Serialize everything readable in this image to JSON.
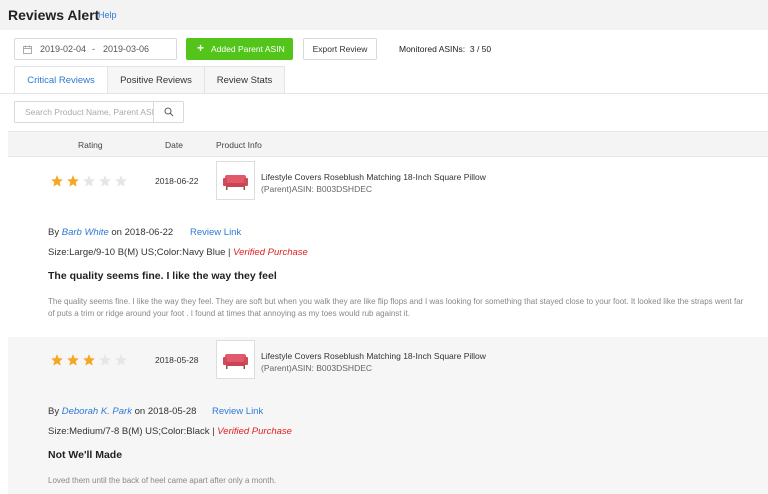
{
  "header": {
    "title": "Reviews Alert",
    "help": "Help"
  },
  "toolbar": {
    "date_start": "2019-02-04",
    "date_sep": "-",
    "date_end": "2019-03-06",
    "add_label": "Added Parent ASIN",
    "export_label": "Export Review",
    "monitored_label": "Monitored ASINs:",
    "monitored_value": "3 / 50",
    "accent": "#52c41a"
  },
  "tabs": [
    {
      "label": "Critical Reviews",
      "active": true
    },
    {
      "label": "Positive Reviews",
      "active": false
    },
    {
      "label": "Review Stats",
      "active": false
    }
  ],
  "search": {
    "placeholder": "Search Product Name, Parent ASIN",
    "icon": "search-icon"
  },
  "table": {
    "columns": [
      "Rating",
      "Date",
      "Product Info"
    ],
    "reviews": [
      {
        "rating": 2,
        "date": "2018-06-22",
        "product_title": "Lifestyle Covers Roseblush Matching 18-Inch Square Pillow",
        "product_asin": "(Parent)ASIN: B003DSHDEC",
        "by": "By",
        "author": "Barb White",
        "on": "on 2018-06-22",
        "review_link": "Review Link",
        "size": "Size:Large/9-10 B(M) US;Color:Navy Blue |",
        "verified": "Verified Purchase",
        "title": "The quality seems fine. I like the way they feel",
        "body_1": "The quality seems fine. I like the way they feel. They are soft but when you walk they are like flip flops and I was looking for something that stayed close to your foot. It looked like the straps went far",
        "body_2": "of puts a trim or ridge around your foot . I found at times that annoying as my toes would rub against it."
      },
      {
        "rating": 3,
        "date": "2018-05-28",
        "product_title": "Lifestyle Covers Roseblush Matching 18-Inch Square Pillow",
        "product_asin": "(Parent)ASIN: B003DSHDEC",
        "by": "By",
        "author": "Deborah K. Park",
        "on": "on 2018-05-28",
        "review_link": "Review Link",
        "size": "Size:Medium/7-8 B(M) US;Color:Black |",
        "verified": "Verified Purchase",
        "title": "Not We'll Made",
        "body_1": "Loved them until the back of heel came apart after only a month."
      }
    ]
  },
  "colors": {
    "star_on": "#f5a623",
    "star_off": "#e6e6e6",
    "link": "#2d7ad6",
    "verified": "#e02020"
  }
}
